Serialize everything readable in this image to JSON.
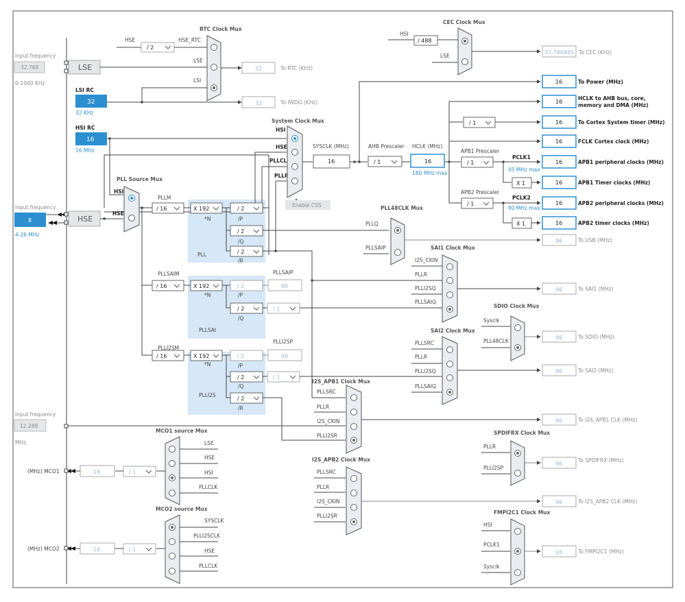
{
  "colors": {
    "accent": "#2b8fd0",
    "pll_region": "#d6e7f7",
    "mux_fill": "#e9edf1",
    "disabled_box": "#e4e6e8"
  },
  "inputs": {
    "lse_input_label": "Input frequency",
    "lse_freq": "32.768",
    "lse_range": "0-1000 KHz",
    "lse": "LSE",
    "lsi_title": "LSI RC",
    "lsi_val": "32",
    "lsi_unit": "32 KHz",
    "hsi_title": "HSI RC",
    "hsi_val": "16",
    "hsi_unit": "16 MHz",
    "hse_input_label": "Input frequency",
    "hse_freq": "8",
    "hse_range": "4-26 MHz",
    "hse": "HSE",
    "ext_input_label": "Input frequency",
    "ext_freq": "12.288",
    "ext_unit": "MHz"
  },
  "rtc": {
    "title": "RTC Clock Mux",
    "hse_in": "HSE",
    "div": "/ 2",
    "hse_rtc": "HSE_RTC",
    "lse_in": "LSE",
    "lsi_in": "LSI",
    "rtc_val": "32",
    "rtc_label": "To RTC (KHz)",
    "iwdg_val": "32",
    "iwdg_label": "To IWDG (KHz)"
  },
  "cec": {
    "title": "CEC Clock Mux",
    "hsi_in": "HSI",
    "div": "/ 488",
    "lse_in": "LSE",
    "val": "32.786885",
    "label": "To CEC (KHz)"
  },
  "sysclk": {
    "title": "System Clock Mux",
    "hsi": "HSI",
    "hse": "HSE",
    "pllclk": "PLLCLK",
    "pllr": "PLLR",
    "css": "Enable CSS",
    "label": "SYSCLK (MHz)",
    "val": "16"
  },
  "ahb": {
    "prescaler_label": "AHB Prescaler",
    "prescaler": "/ 1",
    "hclk_label": "HCLK (MHz)",
    "hclk": "16",
    "hclk_max": "180 MHz max"
  },
  "apb1": {
    "prescaler_label": "APB1 Prescaler",
    "prescaler": "/ 1",
    "pclk": "PCLK1",
    "max": "45 MHz max",
    "mult": "X 1"
  },
  "apb2": {
    "prescaler_label": "APB2 Prescaler",
    "prescaler": "/ 1",
    "pclk": "PCLK2",
    "max": "90 MHz max",
    "mult": "X 1"
  },
  "cortex_div": "/ 1",
  "outputs": [
    {
      "val": "16",
      "label": "To Power (MHz)"
    },
    {
      "val": "16",
      "label": "HCLK to AHB bus, core,",
      "label2": "memory and DMA (MHz)"
    },
    {
      "val": "16",
      "label": "To Cortex System timer (MHz)"
    },
    {
      "val": "16",
      "label": "FCLK Cortex clock (MHz)"
    },
    {
      "val": "16",
      "label": "APB1 peripheral clocks (MHz)"
    },
    {
      "val": "16",
      "label": "APB1 Timer clocks (MHz)"
    },
    {
      "val": "16",
      "label": "APB2 peripheral clocks (MHz)"
    },
    {
      "val": "16",
      "label": "APB2 timer clocks (MHz)"
    }
  ],
  "pll": {
    "src_title": "PLL Source Mux",
    "src_hsi": "HSI",
    "src_hse": "HSE",
    "pllm_label": "PLLM",
    "pllm": "/ 16",
    "n": "X 192",
    "n_label": "*N",
    "p": "/ 2",
    "p_label": "/P",
    "q": "/ 2",
    "q_label": "/Q",
    "r": "/ 2",
    "r_label": "/R",
    "name": "PLL"
  },
  "pllsai": {
    "label": "PLLSAIM",
    "m": "/ 16",
    "n": "X 192",
    "n_label": "*N",
    "p": "/ 2",
    "p_label": "/P",
    "p_name": "PLLSAIP",
    "p_val": "96",
    "q": "/ 2",
    "q_label": "/Q",
    "qdiv": "/ 1",
    "name": "PLLSAI"
  },
  "plli2s": {
    "label": "PLLI2SM",
    "m": "/ 16",
    "n": "X 192",
    "n_label": "*N",
    "p": "/ 2",
    "p_label": "/P",
    "p_name": "PLLI2SP",
    "p_val": "96",
    "q": "/ 2",
    "q_label": "/Q",
    "qdiv": "/ 1",
    "r": "/ 2",
    "r_label": "/R",
    "name": "PLLI2S"
  },
  "pll48": {
    "title": "PLL48CLK Mux",
    "in1": "PLLQ",
    "in2": "PLLSAIP",
    "val": "96",
    "label": "To USB (MHz)"
  },
  "sai1": {
    "title": "SAI1 Clock Mux",
    "in1": "I2S_CKIN",
    "in2": "PLLR",
    "in3": "PLLI2SQ",
    "in4": "PLLSAIQ",
    "val": "96",
    "label": "To SAI1 (MHz)"
  },
  "sdio": {
    "title": "SDIO Clock Mux",
    "in1": "Sysclk",
    "in2": "PLL48CLK",
    "val": "96",
    "label": "To SDIO (MHz)"
  },
  "sai2": {
    "title": "SAI2 Clock Mux",
    "in1": "PLLSRC",
    "in2": "PLLR",
    "in3": "PLLI2SQ",
    "in4": "PLLSAIQ",
    "val": "96",
    "label": "To SAI2 (MHz)"
  },
  "i2s1": {
    "title": "I2S_APB1 Clock Mux",
    "in1": "PLLSRC",
    "in2": "PLLR",
    "in3": "I2S_CKIN",
    "in4": "PLLI2SR",
    "val": "96",
    "label": "To I2S_APB1 CLK (MHz)"
  },
  "spdif": {
    "title": "SPDIFRX Clock Mux",
    "in1": "PLLR",
    "in2": "PLLI2SP",
    "val": "96",
    "label": "To SPDIFRX (MHz)"
  },
  "i2s2": {
    "title": "I2S_APB2 Clock Mux",
    "in1": "PLLSRC",
    "in2": "PLLR",
    "in3": "I2S_CKIN",
    "in4": "PLLI2SR",
    "val": "96",
    "label": "To I2S_APB2 CLK (MHz)"
  },
  "fmpi2c": {
    "title": "FMPI2C1 Clock Mux",
    "in1": "HSI",
    "in2": "PCLK1",
    "in3": "Sysclk",
    "val": "16",
    "label": "To FMPI2C1 (MHz)"
  },
  "mco1": {
    "title": "MCO1 source Mux",
    "in1": "LSE",
    "in2": "HSE",
    "in3": "HSI",
    "in4": "PLLCLK",
    "label": "(MHz) MCO1",
    "val": "16",
    "div": "/ 1"
  },
  "mco2": {
    "title": "MCO2 source Mux",
    "in1": "SYSCLK",
    "in2": "PLLI2SCLK",
    "in3": "HSE",
    "in4": "PLLCLK",
    "label": "(MHz) MCO2",
    "val": "16",
    "div": "/ 1"
  }
}
